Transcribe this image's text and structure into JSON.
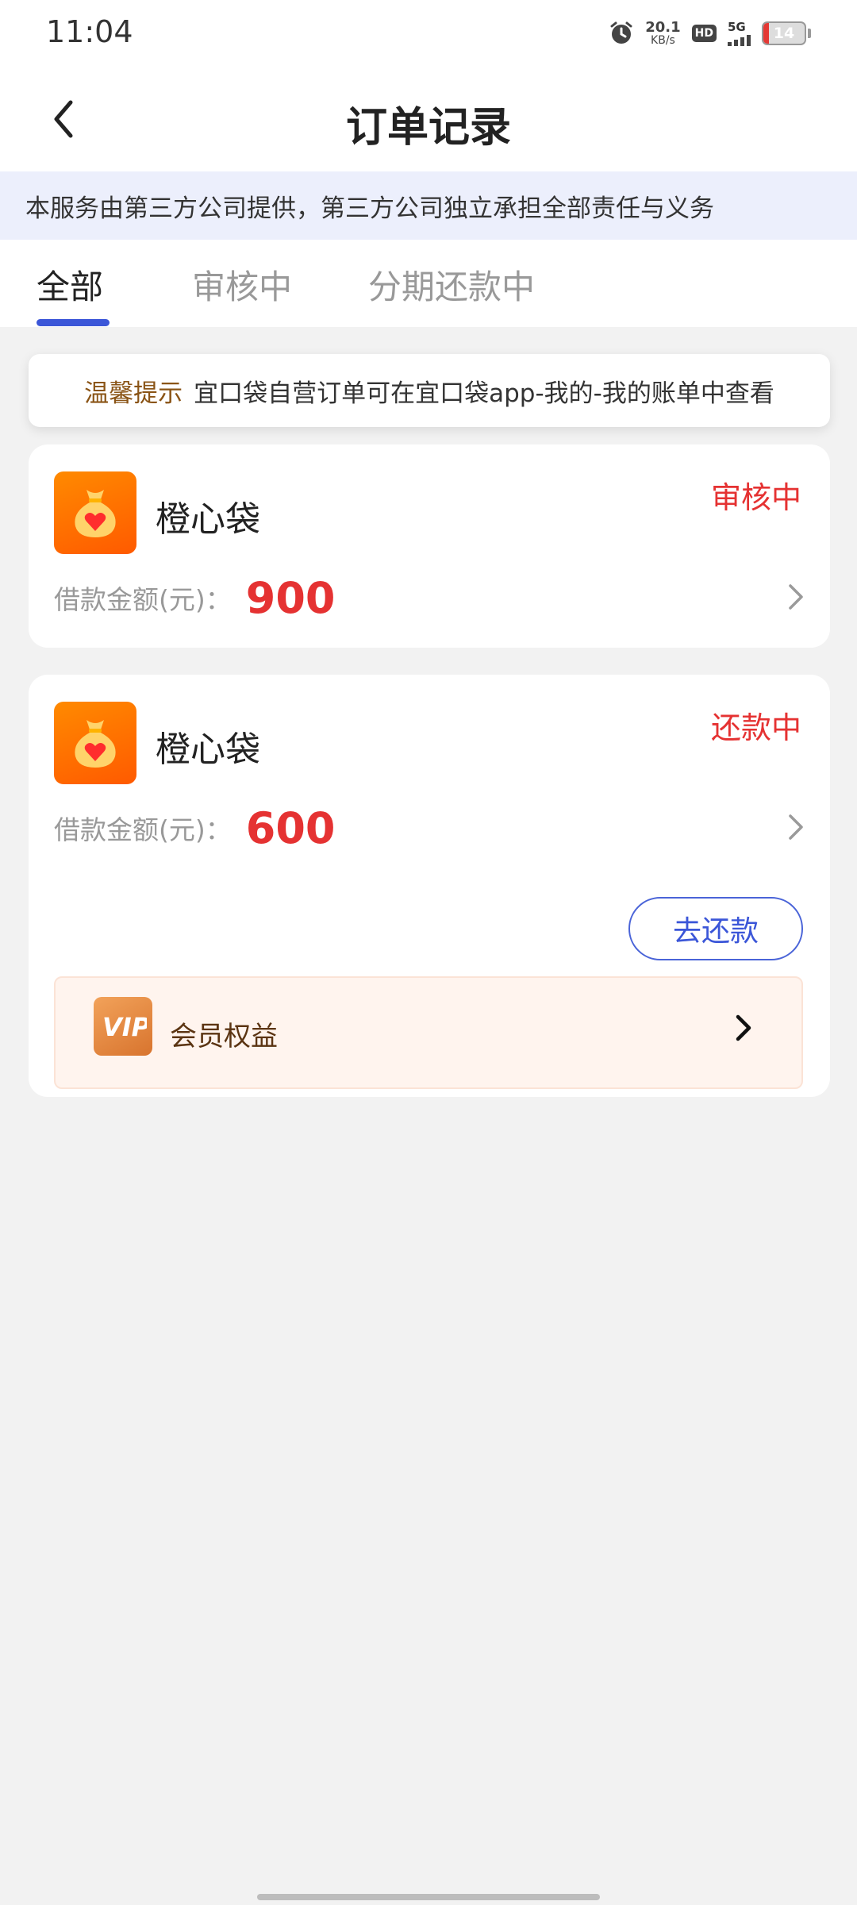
{
  "status_bar": {
    "time": "11:04",
    "net_speed_value": "20.1",
    "net_speed_unit": "KB/s",
    "hd_label": "HD",
    "network_label": "5G",
    "battery_level": "14"
  },
  "header": {
    "title": "订单记录",
    "back_icon": "chevron-left-icon"
  },
  "notice": {
    "text": "本服务由第三方公司提供，第三方公司独立承担全部责任与义务"
  },
  "tabs": [
    {
      "label": "全部",
      "active": true
    },
    {
      "label": "审核中",
      "active": false
    },
    {
      "label": "分期还款中",
      "active": false
    }
  ],
  "tip": {
    "label": "温馨提示",
    "text": "宜口袋自营订单可在宜口袋app-我的-我的账单中查看"
  },
  "orders": [
    {
      "lender": "橙心袋",
      "status": "审核中",
      "amount_label": "借款金额(元)：",
      "amount": "900"
    },
    {
      "lender": "橙心袋",
      "status": "还款中",
      "amount_label": "借款金额(元)：",
      "amount": "600",
      "repay_button": "去还款",
      "vip": {
        "label": "会员权益",
        "icon_text": "VIP"
      }
    }
  ],
  "colors": {
    "accent_blue": "#3b56d8",
    "status_red": "#e53232",
    "brand_orange": "#ff6a00",
    "notice_bg": "#eceffc",
    "tip_label": "#8a5416"
  }
}
